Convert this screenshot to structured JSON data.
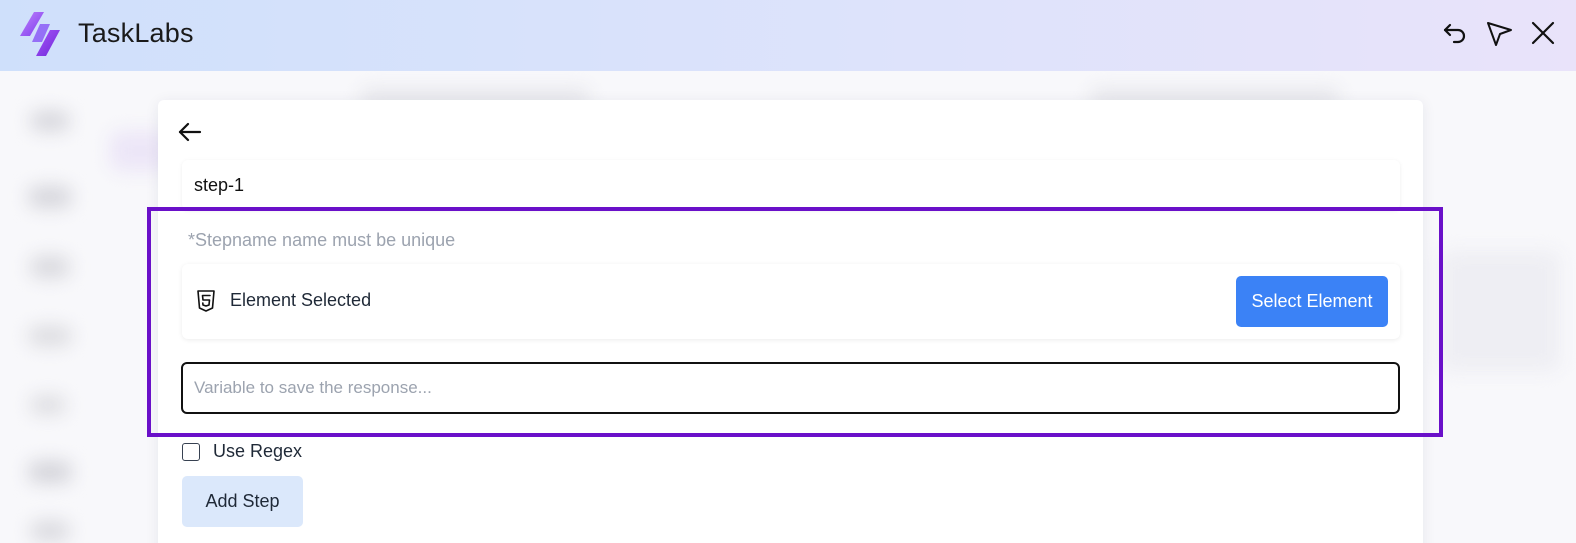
{
  "app": {
    "title": "TaskLabs"
  },
  "header": {
    "actions": [
      {
        "icon": "undo-icon"
      },
      {
        "icon": "send-icon"
      },
      {
        "icon": "close-icon"
      }
    ]
  },
  "form": {
    "back_icon": "arrow-left-icon",
    "step_name_value": "step-1",
    "step_name_hint": "*Stepname name must be unique",
    "element": {
      "icon": "html5-icon",
      "label": "Element Selected",
      "select_button_label": "Select Element"
    },
    "variable_placeholder": "Variable to save the response...",
    "use_regex_label": "Use Regex",
    "use_regex_checked": false,
    "add_step_label": "Add Step"
  },
  "colors": {
    "primary_button": "#3b82f6",
    "secondary_button": "#dbe8fb",
    "highlight_border": "#6a10c9",
    "hint_text": "#9ca3af"
  }
}
